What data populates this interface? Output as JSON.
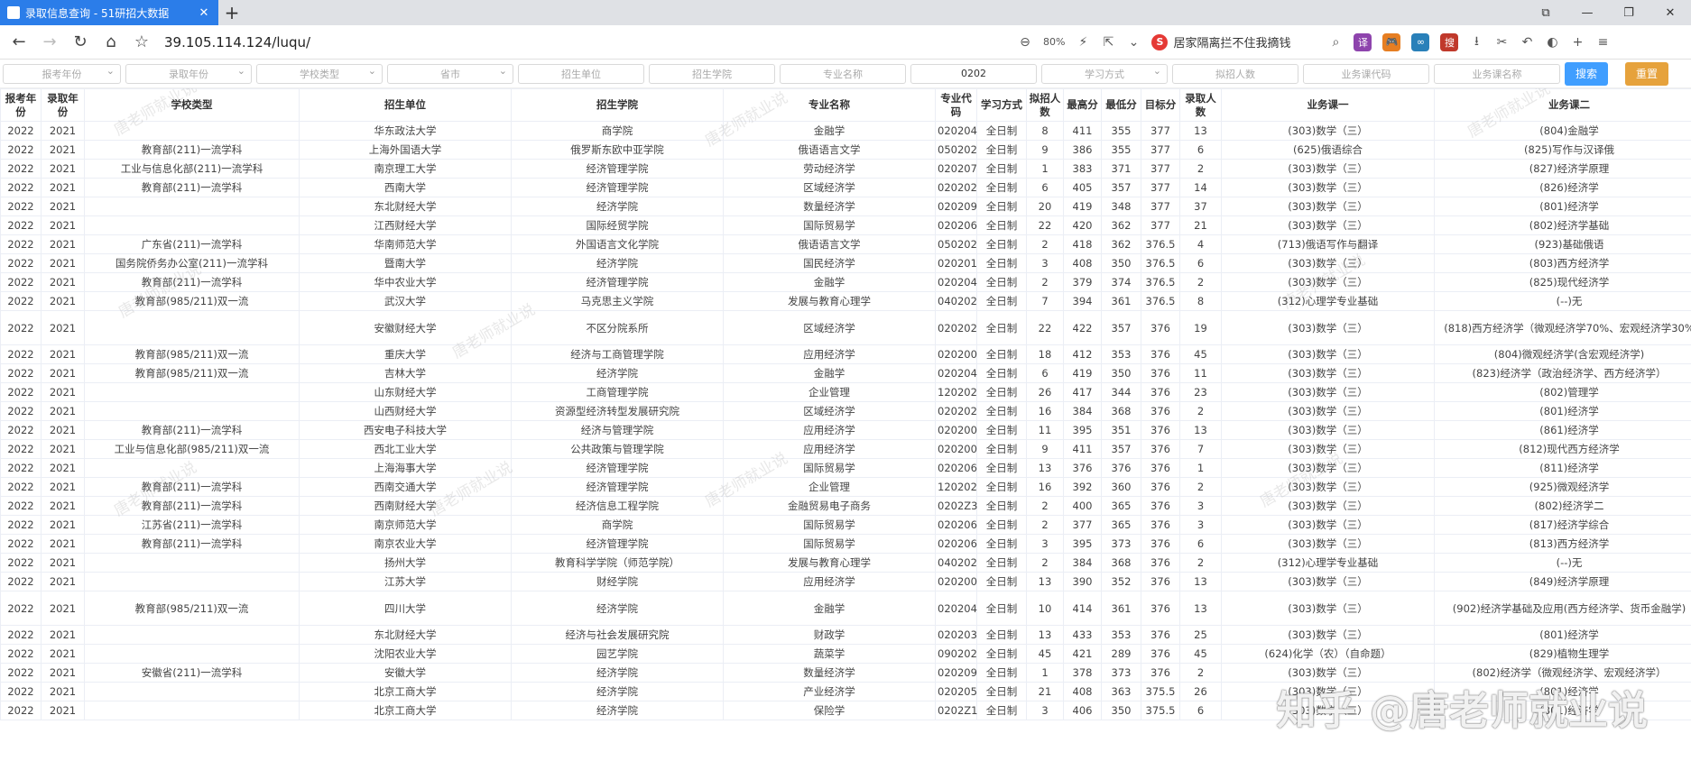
{
  "browser": {
    "tab_title": "录取信息查询 - 51研招大数据",
    "url": "39.105.114.124/luqu/",
    "zoom": "80%",
    "search_text": "居家隔离拦不住我摘钱",
    "icons": {
      "back": "←",
      "forward": "→",
      "reload": "↻",
      "home": "⌂",
      "star": "☆",
      "zoom": "⊖",
      "flash": "⚡",
      "share": "⇱",
      "chevron": "⌄",
      "search": "⌕",
      "download": "⭳",
      "cut": "✂",
      "undo": "↶",
      "moon": "◐",
      "plus": "+",
      "menu": "≡",
      "close": "✕",
      "newtab": "+",
      "win_a": "⧉",
      "win_min": "—",
      "win_max": "❐",
      "win_close": "✕",
      "search_logo": "S"
    },
    "extensions": [
      {
        "label": "译",
        "color": "#8e44ad"
      },
      {
        "label": "🎮",
        "color": "#e67e22"
      },
      {
        "label": "∞",
        "color": "#2980b9"
      },
      {
        "label": "搜",
        "color": "#c0392b"
      }
    ]
  },
  "filters": {
    "fields": [
      {
        "placeholder": "报考年份",
        "value": "",
        "dropdown": true
      },
      {
        "placeholder": "录取年份",
        "value": "",
        "dropdown": true
      },
      {
        "placeholder": "学校类型",
        "value": "",
        "dropdown": true
      },
      {
        "placeholder": "省市",
        "value": "",
        "dropdown": true
      },
      {
        "placeholder": "招生单位",
        "value": "",
        "dropdown": false
      },
      {
        "placeholder": "招生学院",
        "value": "",
        "dropdown": false
      },
      {
        "placeholder": "专业名称",
        "value": "",
        "dropdown": false
      },
      {
        "placeholder": "专业代码",
        "value": "0202",
        "dropdown": false
      },
      {
        "placeholder": "学习方式",
        "value": "",
        "dropdown": true
      },
      {
        "placeholder": "拟招人数",
        "value": "",
        "dropdown": false
      },
      {
        "placeholder": "业务课代码",
        "value": "",
        "dropdown": false
      },
      {
        "placeholder": "业务课名称",
        "value": "",
        "dropdown": false
      }
    ],
    "search_label": "搜索",
    "reset_label": "重置"
  },
  "table": {
    "headers": [
      "报考年份",
      "录取年份",
      "学校类型",
      "招生单位",
      "招生学院",
      "专业名称",
      "专业代码",
      "学习方式",
      "拟招人数",
      "最高分",
      "最低分",
      "目标分",
      "录取人数",
      "业务课一",
      "业务课二"
    ],
    "rows": [
      [
        "2022",
        "2021",
        "",
        "华东政法大学",
        "商学院",
        "金融学",
        "020204",
        "全日制",
        "8",
        "411",
        "355",
        "377",
        "13",
        "(303)数学（三）",
        "(804)金融学"
      ],
      [
        "2022",
        "2021",
        "教育部(211)一流学科",
        "上海外国语大学",
        "俄罗斯东欧中亚学院",
        "俄语语言文学",
        "050202",
        "全日制",
        "9",
        "386",
        "355",
        "377",
        "6",
        "(625)俄语综合",
        "(825)写作与汉译俄"
      ],
      [
        "2022",
        "2021",
        "工业与信息化部(211)一流学科",
        "南京理工大学",
        "经济管理学院",
        "劳动经济学",
        "020207",
        "全日制",
        "1",
        "383",
        "371",
        "377",
        "2",
        "(303)数学（三）",
        "(827)经济学原理"
      ],
      [
        "2022",
        "2021",
        "教育部(211)一流学科",
        "西南大学",
        "经济管理学院",
        "区域经济学",
        "020202",
        "全日制",
        "6",
        "405",
        "357",
        "377",
        "14",
        "(303)数学（三）",
        "(826)经济学"
      ],
      [
        "2022",
        "2021",
        "",
        "东北财经大学",
        "经济学院",
        "数量经济学",
        "020209",
        "全日制",
        "20",
        "419",
        "348",
        "377",
        "37",
        "(303)数学（三）",
        "(801)经济学"
      ],
      [
        "2022",
        "2021",
        "",
        "江西财经大学",
        "国际经贸学院",
        "国际贸易学",
        "020206",
        "全日制",
        "22",
        "420",
        "362",
        "377",
        "21",
        "(303)数学（三）",
        "(802)经济学基础"
      ],
      [
        "2022",
        "2021",
        "广东省(211)一流学科",
        "华南师范大学",
        "外国语言文化学院",
        "俄语语言文学",
        "050202",
        "全日制",
        "2",
        "418",
        "362",
        "376.5",
        "4",
        "(713)俄语写作与翻译",
        "(923)基础俄语"
      ],
      [
        "2022",
        "2021",
        "国务院侨务办公室(211)一流学科",
        "暨南大学",
        "经济学院",
        "国民经济学",
        "020201",
        "全日制",
        "3",
        "408",
        "350",
        "376.5",
        "6",
        "(303)数学（三）",
        "(803)西方经济学"
      ],
      [
        "2022",
        "2021",
        "教育部(211)一流学科",
        "华中农业大学",
        "经济管理学院",
        "金融学",
        "020204",
        "全日制",
        "2",
        "379",
        "374",
        "376.5",
        "2",
        "(303)数学（三）",
        "(825)现代经济学"
      ],
      [
        "2022",
        "2021",
        "教育部(985/211)双一流",
        "武汉大学",
        "马克思主义学院",
        "发展与教育心理学",
        "040202",
        "全日制",
        "7",
        "394",
        "361",
        "376.5",
        "8",
        "(312)心理学专业基础",
        "(--)无"
      ],
      [
        "2022",
        "2021",
        "",
        "安徽财经大学",
        "不区分院系所",
        "区域经济学",
        "020202",
        "全日制",
        "22",
        "422",
        "357",
        "376",
        "19",
        "(303)数学（三）",
        "(818)西方经济学（微观经济学70%、宏观经济学30%"
      ],
      [
        "2022",
        "2021",
        "教育部(985/211)双一流",
        "重庆大学",
        "经济与工商管理学院",
        "应用经济学",
        "020200",
        "全日制",
        "18",
        "412",
        "353",
        "376",
        "45",
        "(303)数学（三）",
        "(804)微观经济学(含宏观经济学)"
      ],
      [
        "2022",
        "2021",
        "教育部(985/211)双一流",
        "吉林大学",
        "经济学院",
        "金融学",
        "020204",
        "全日制",
        "6",
        "419",
        "350",
        "376",
        "11",
        "(303)数学（三）",
        "(823)经济学（政治经济学、西方经济学）"
      ],
      [
        "2022",
        "2021",
        "",
        "山东财经大学",
        "工商管理学院",
        "企业管理",
        "120202",
        "全日制",
        "26",
        "417",
        "344",
        "376",
        "23",
        "(303)数学（三）",
        "(802)管理学"
      ],
      [
        "2022",
        "2021",
        "",
        "山西财经大学",
        "资源型经济转型发展研究院",
        "区域经济学",
        "020202",
        "全日制",
        "16",
        "384",
        "368",
        "376",
        "2",
        "(303)数学（三）",
        "(801)经济学"
      ],
      [
        "2022",
        "2021",
        "教育部(211)一流学科",
        "西安电子科技大学",
        "经济与管理学院",
        "应用经济学",
        "020200",
        "全日制",
        "11",
        "395",
        "351",
        "376",
        "13",
        "(303)数学（三）",
        "(861)经济学"
      ],
      [
        "2022",
        "2021",
        "工业与信息化部(985/211)双一流",
        "西北工业大学",
        "公共政策与管理学院",
        "应用经济学",
        "020200",
        "全日制",
        "9",
        "411",
        "357",
        "376",
        "7",
        "(303)数学（三）",
        "(812)现代西方经济学"
      ],
      [
        "2022",
        "2021",
        "",
        "上海海事大学",
        "经济管理学院",
        "国际贸易学",
        "020206",
        "全日制",
        "13",
        "376",
        "376",
        "376",
        "1",
        "(303)数学（三）",
        "(811)经济学"
      ],
      [
        "2022",
        "2021",
        "教育部(211)一流学科",
        "西南交通大学",
        "经济管理学院",
        "企业管理",
        "120202",
        "全日制",
        "16",
        "392",
        "360",
        "376",
        "2",
        "(303)数学（三）",
        "(925)微观经济学"
      ],
      [
        "2022",
        "2021",
        "教育部(211)一流学科",
        "西南财经大学",
        "经济信息工程学院",
        "金融贸易电子商务",
        "0202Z3",
        "全日制",
        "2",
        "400",
        "365",
        "376",
        "3",
        "(303)数学（三）",
        "(802)经济学二"
      ],
      [
        "2022",
        "2021",
        "江苏省(211)一流学科",
        "南京师范大学",
        "商学院",
        "国际贸易学",
        "020206",
        "全日制",
        "2",
        "377",
        "365",
        "376",
        "3",
        "(303)数学（三）",
        "(817)经济学综合"
      ],
      [
        "2022",
        "2021",
        "教育部(211)一流学科",
        "南京农业大学",
        "经济管理学院",
        "国际贸易学",
        "020206",
        "全日制",
        "3",
        "395",
        "373",
        "376",
        "6",
        "(303)数学（三）",
        "(813)西方经济学"
      ],
      [
        "2022",
        "2021",
        "",
        "扬州大学",
        "教育科学学院（师范学院）",
        "发展与教育心理学",
        "040202",
        "全日制",
        "2",
        "384",
        "368",
        "376",
        "2",
        "(312)心理学专业基础",
        "(--)无"
      ],
      [
        "2022",
        "2021",
        "",
        "江苏大学",
        "财经学院",
        "应用经济学",
        "020200",
        "全日制",
        "13",
        "390",
        "352",
        "376",
        "13",
        "(303)数学（三）",
        "(849)经济学原理"
      ],
      [
        "2022",
        "2021",
        "教育部(985/211)双一流",
        "四川大学",
        "经济学院",
        "金融学",
        "020204",
        "全日制",
        "10",
        "414",
        "361",
        "376",
        "13",
        "(303)数学（三）",
        "(902)经济学基础及应用(西方经济学、货币金融学)"
      ],
      [
        "2022",
        "2021",
        "",
        "东北财经大学",
        "经济与社会发展研究院",
        "财政学",
        "020203",
        "全日制",
        "13",
        "433",
        "353",
        "376",
        "25",
        "(303)数学（三）",
        "(801)经济学"
      ],
      [
        "2022",
        "2021",
        "",
        "沈阳农业大学",
        "园艺学院",
        "蔬菜学",
        "090202",
        "全日制",
        "45",
        "421",
        "289",
        "376",
        "45",
        "(624)化学（农）（自命题）",
        "(829)植物生理学"
      ],
      [
        "2022",
        "2021",
        "安徽省(211)一流学科",
        "安徽大学",
        "经济学院",
        "数量经济学",
        "020209",
        "全日制",
        "1",
        "378",
        "373",
        "376",
        "2",
        "(303)数学（三）",
        "(802)经济学（微观经济学、宏观经济学）"
      ],
      [
        "2022",
        "2021",
        "",
        "北京工商大学",
        "经济学院",
        "产业经济学",
        "020205",
        "全日制",
        "21",
        "408",
        "363",
        "375.5",
        "26",
        "(303)数学（三）",
        "(801)经济学"
      ],
      [
        "2022",
        "2021",
        "",
        "北京工商大学",
        "经济学院",
        "保险学",
        "0202Z1",
        "全日制",
        "3",
        "406",
        "350",
        "375.5",
        "6",
        "(303)数学（三）",
        "(801)经济学"
      ]
    ]
  },
  "watermark": {
    "small": "唐老师就业说",
    "big": "知乎 @唐老师就业说"
  }
}
